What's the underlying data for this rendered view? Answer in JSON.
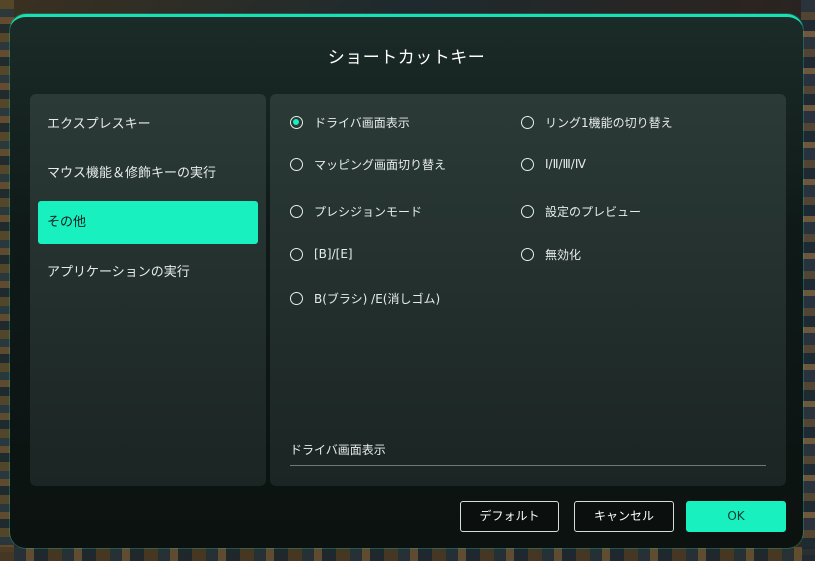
{
  "dialog": {
    "title": "ショートカットキー"
  },
  "sidebar": {
    "items": [
      {
        "label": "エクスプレスキー",
        "active": false
      },
      {
        "label": "マウス機能＆修飾キーの実行",
        "active": false
      },
      {
        "label": "その他",
        "active": true
      },
      {
        "label": "アプリケーションの実行",
        "active": false
      }
    ]
  },
  "options": {
    "left": [
      {
        "label": "ドライバ画面表示",
        "checked": true
      },
      {
        "label": "マッピング画面切り替え",
        "checked": false
      },
      {
        "label": "プレシジョンモード",
        "checked": false
      },
      {
        "label": "[B]/[E]",
        "checked": false
      },
      {
        "label": "B(ブラシ) /E(消しゴム)",
        "checked": false
      }
    ],
    "right": [
      {
        "label": "リング1機能の切り替え",
        "checked": false
      },
      {
        "label": "Ⅰ/Ⅱ/Ⅲ/Ⅳ",
        "checked": false
      },
      {
        "label": "設定のプレビュー",
        "checked": false
      },
      {
        "label": "無効化",
        "checked": false
      }
    ]
  },
  "selected_value": "ドライバ画面表示",
  "buttons": {
    "default_label": "デフォルト",
    "cancel_label": "キャンセル",
    "ok_label": "OK"
  },
  "colors": {
    "accent": "#18f0c0",
    "panel": "#2b3a37",
    "dialog_bg": "#0f1a18"
  }
}
